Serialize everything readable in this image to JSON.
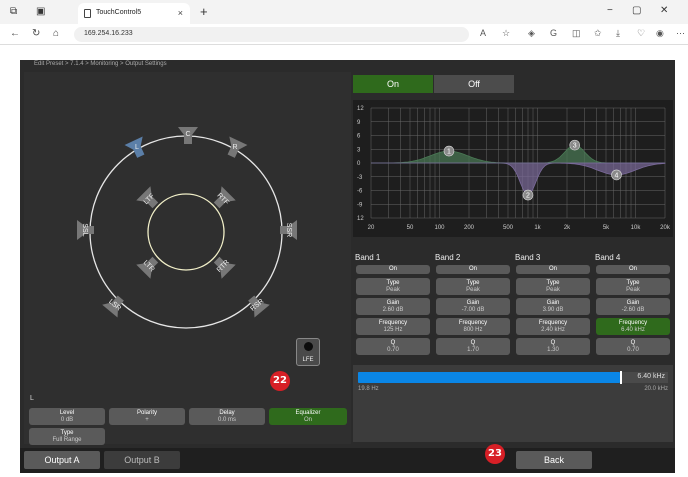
{
  "browser": {
    "tab_title": "TouchControl5",
    "url": "169.254.16.233",
    "new_tab": "+",
    "close": "×",
    "win_min": "−",
    "win_max": "▢",
    "win_close": "✕"
  },
  "app": {
    "breadcrumb": "Edit Preset > 7.1.4 > Monitoring > Output Settings",
    "speakers": {
      "L": "L",
      "C": "C",
      "R": "R",
      "SSL": "SSL",
      "SSR": "SSR",
      "LTF": "LTF",
      "RTF": "RTF",
      "LTR": "LTR",
      "RTR": "RTR",
      "LSR": "LSR",
      "RSR": "RSR",
      "LFE": "LFE"
    },
    "channel": "L",
    "controls": [
      {
        "title": "Level",
        "value": "0 dB"
      },
      {
        "title": "Polarity",
        "value": "+"
      },
      {
        "title": "Delay",
        "value": "0.0 ms"
      },
      {
        "title": "Equalizer",
        "value": "On"
      }
    ],
    "type_ctrl": {
      "title": "Type",
      "value": "Full Range"
    },
    "eq_on": "On",
    "eq_off": "Off",
    "graph": {
      "y_ticks": [
        "12",
        "9",
        "6",
        "3",
        "0",
        "-3",
        "-6",
        "-9",
        "12"
      ],
      "x_ticks": [
        "20",
        "50",
        "100",
        "200",
        "500",
        "1k",
        "2k",
        "5k",
        "10k",
        "20k"
      ],
      "markers": [
        "1",
        "2",
        "3",
        "4"
      ]
    },
    "bands": [
      {
        "name": "Band 1",
        "state": "On",
        "type": "Peak",
        "gain": "2.60 dB",
        "freq": "125 Hz",
        "q": "0.70"
      },
      {
        "name": "Band 2",
        "state": "On",
        "type": "Peak",
        "gain": "-7.00 dB",
        "freq": "800 Hz",
        "q": "1.70"
      },
      {
        "name": "Band 3",
        "state": "On",
        "type": "Peak",
        "gain": "3.90 dB",
        "freq": "2.40 kHz",
        "q": "1.30"
      },
      {
        "name": "Band 4",
        "state": "On",
        "type": "Peak",
        "gain": "-2.60 dB",
        "freq": "6.40 kHz",
        "q": "0.70"
      }
    ],
    "labels": {
      "type": "Type",
      "gain": "Gain",
      "freq": "Frequency",
      "q": "Q"
    },
    "freq_slider": {
      "value": "6.40 kHz",
      "min": "19.8 Hz",
      "max": "20.0 kHz",
      "fill_fraction": 0.845
    },
    "out_a": "Output A",
    "out_b": "Output B",
    "back": "Back",
    "badge22": "22",
    "badge23": "23"
  }
}
